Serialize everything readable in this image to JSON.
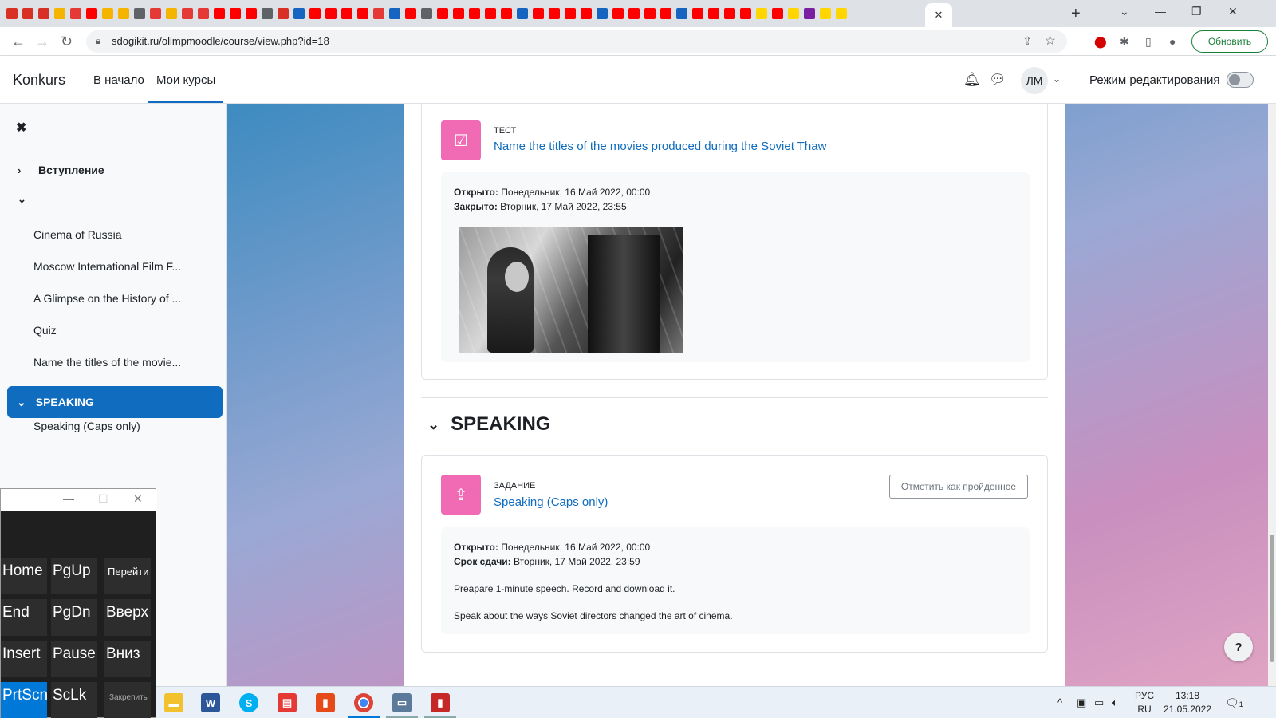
{
  "browser": {
    "url": "sdogikit.ru/olimpmoodle/course/view.php?id=18",
    "update_label": "Обновить",
    "close_tab_glyph": "✕",
    "new_tab_glyph": "+",
    "tab_favicon_colors": [
      "#d93025",
      "#d93025",
      "#d93025",
      "#f4b400",
      "#e53935",
      "#ff0000",
      "#f4b400",
      "#f4b400",
      "#5f6368",
      "#e53935",
      "#f4b400",
      "#e53935",
      "#e53935",
      "#ff0000",
      "#ff0000",
      "#ff0000",
      "#5f6368",
      "#d93025",
      "#1565c0",
      "#ff0000",
      "#ff0000",
      "#ff0000",
      "#ff0000",
      "#e53935",
      "#1565c0",
      "#ff0000",
      "#5f6368",
      "#ff0000",
      "#ff0000",
      "#ff0000",
      "#ff0000",
      "#ff0000",
      "#1565c0",
      "#ff0000",
      "#ff0000",
      "#ff0000",
      "#ff0000",
      "#1565c0",
      "#ff0000",
      "#ff0000",
      "#ff0000",
      "#ff0000",
      "#1565c0",
      "#ff0000",
      "#ff0000",
      "#ff0000",
      "#ff0000",
      "#ffd600",
      "#ff0000",
      "#ffd600",
      "#7b1fa2",
      "#ffd600",
      "#ffd600"
    ]
  },
  "navbar": {
    "brand": "Konkurs",
    "links": [
      "В начало",
      "Мои курсы"
    ],
    "avatar_initials": "ЛМ",
    "edit_mode_label": "Режим редактирования"
  },
  "drawer": {
    "close_glyph": "✖",
    "sections": [
      {
        "label": "Вступление",
        "chevron": "›"
      },
      {
        "label": "",
        "chevron": "⌄"
      }
    ],
    "items": [
      "Cinema of Russia",
      "Moscow International Film F...",
      "A Glimpse on the History of ...",
      "Quiz",
      "Name the titles of the movie..."
    ],
    "active_section": "SPEAKING",
    "active_items": [
      "Speaking (Caps only)"
    ]
  },
  "activity1": {
    "type": "Тест",
    "title": "Name the titles of the movies produced during the Soviet Thaw",
    "opened_label": "Открыто:",
    "opened_value": "Понедельник, 16 Май 2022, 00:00",
    "closed_label": "Закрыто:",
    "closed_value": "Вторник, 17 Май 2022, 23:55"
  },
  "section_speaking": {
    "title": "SPEAKING"
  },
  "activity2": {
    "type": "Задание",
    "title": "Speaking (Caps only)",
    "mark_done_label": "Отметить как пройденное",
    "opened_label": "Открыто:",
    "opened_value": "Понедельник, 16 Май 2022, 00:00",
    "due_label": "Срок сдачи:",
    "due_value": "Вторник, 17 Май 2022, 23:59",
    "description": [
      "Preapare 1-minute speech. Record and download it.",
      "Speak about the ways Soviet directors changed the art of cinema."
    ]
  },
  "help_glyph": "?",
  "osk": {
    "keys": [
      {
        "label": "Home",
        "style": "normal"
      },
      {
        "label": "PgUp",
        "style": "normal"
      },
      {
        "label": "Перейти",
        "style": "small"
      },
      {
        "label": "End",
        "style": "normal"
      },
      {
        "label": "PgDn",
        "style": "normal"
      },
      {
        "label": "Вверх",
        "style": "normal"
      },
      {
        "label": "Insert",
        "style": "normal"
      },
      {
        "label": "Pause",
        "style": "normal"
      },
      {
        "label": "Вниз",
        "style": "normal"
      },
      {
        "label": "PrtScn",
        "style": "blue"
      },
      {
        "label": "ScLk",
        "style": "normal"
      },
      {
        "label": "Закрепить",
        "style": "tiny"
      }
    ]
  },
  "taskbar": {
    "lang_line1": "РУС",
    "lang_line2": "RU",
    "time": "13:18",
    "date": "21.05.2022",
    "notification_count": "1"
  }
}
